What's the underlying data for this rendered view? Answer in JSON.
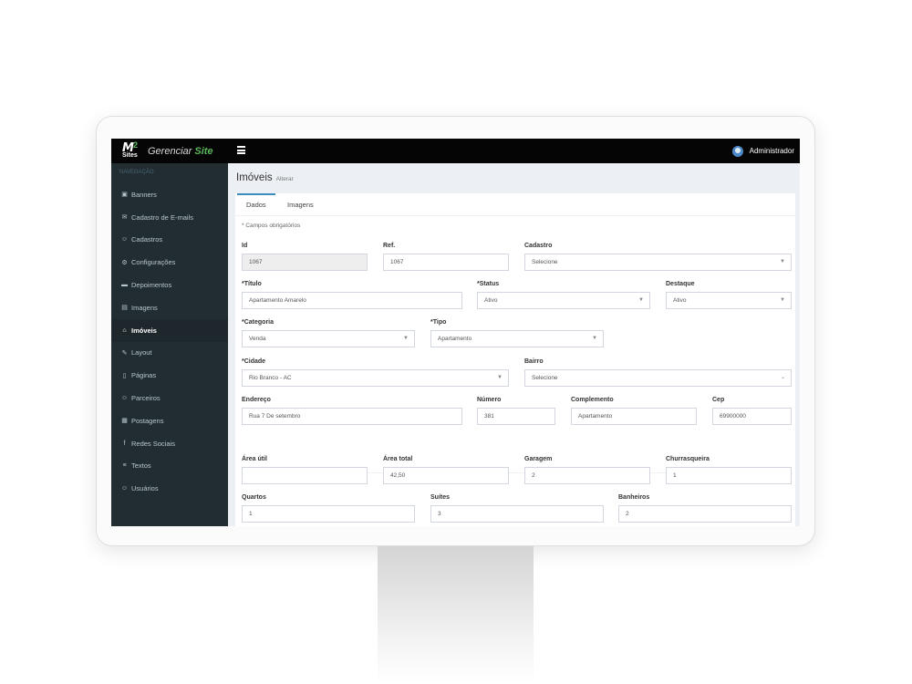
{
  "brand": {
    "logo_mark": "M",
    "logo_sup": "2",
    "logo_sub": "Sites",
    "title_plain": "Gerenciar ",
    "title_accent": "Site",
    "accent_color": "#5cb85c"
  },
  "topbar": {
    "menu_icon": "hamburger-icon",
    "user_name": "Administrador"
  },
  "sidebar": {
    "header": "NAVEGAÇÃO",
    "items": [
      {
        "label": "Banners",
        "icon": "▣"
      },
      {
        "label": "Cadastro de E-mails",
        "icon": "✉"
      },
      {
        "label": "Cadastros",
        "icon": "☺"
      },
      {
        "label": "Configurações",
        "icon": "⚙"
      },
      {
        "label": "Depoimentos",
        "icon": "▬"
      },
      {
        "label": "Imagens",
        "icon": "▤"
      },
      {
        "label": "Imóveis",
        "icon": "⌂"
      },
      {
        "label": "Layout",
        "icon": "✎"
      },
      {
        "label": "Páginas",
        "icon": "▯"
      },
      {
        "label": "Parceiros",
        "icon": "☺"
      },
      {
        "label": "Postagens",
        "icon": "▦"
      },
      {
        "label": "Redes Sociais",
        "icon": "f"
      },
      {
        "label": "Textos",
        "icon": "≡"
      },
      {
        "label": "Usuários",
        "icon": "☺"
      }
    ],
    "active_index": 6
  },
  "page": {
    "title": "Imóveis",
    "subtitle": "Alterar"
  },
  "tabs": [
    "Dados",
    "Imagens"
  ],
  "form": {
    "required_note": "* Campos obrigatórios",
    "id": {
      "label": "Id",
      "value": "1067"
    },
    "ref": {
      "label": "Ref.",
      "value": "1067"
    },
    "cadastro": {
      "label": "Cadastro",
      "value": "Selecione"
    },
    "titulo": {
      "label": "*Título",
      "value": "Apartamento Amarelo"
    },
    "status": {
      "label": "*Status",
      "value": "Ativo"
    },
    "destaque": {
      "label": "Destaque",
      "value": "Ativo"
    },
    "categoria": {
      "label": "*Categoria",
      "value": "Venda"
    },
    "tipo": {
      "label": "*Tipo",
      "value": "Apartamento"
    },
    "cidade": {
      "label": "*Cidade",
      "value": "Rio Branco - AC"
    },
    "bairro": {
      "label": "Bairro",
      "value": "Selecione"
    },
    "endereco": {
      "label": "Endereço",
      "value": "Rua 7 De setembro"
    },
    "numero": {
      "label": "Número",
      "value": "381"
    },
    "complemento": {
      "label": "Complemento",
      "value": "Apartamento"
    },
    "cep": {
      "label": "Cep",
      "value": "69900000"
    },
    "area_util": {
      "label": "Área útil",
      "value": ""
    },
    "area_total": {
      "label": "Área total",
      "value": "42,50"
    },
    "garagem": {
      "label": "Garagem",
      "value": "2"
    },
    "churrasqueira": {
      "label": "Churrasqueira",
      "value": "1"
    },
    "quartos": {
      "label": "Quartos",
      "value": "1"
    },
    "suites": {
      "label": "Suítes",
      "value": "3"
    },
    "banheiros": {
      "label": "Banheiros",
      "value": "2"
    }
  }
}
